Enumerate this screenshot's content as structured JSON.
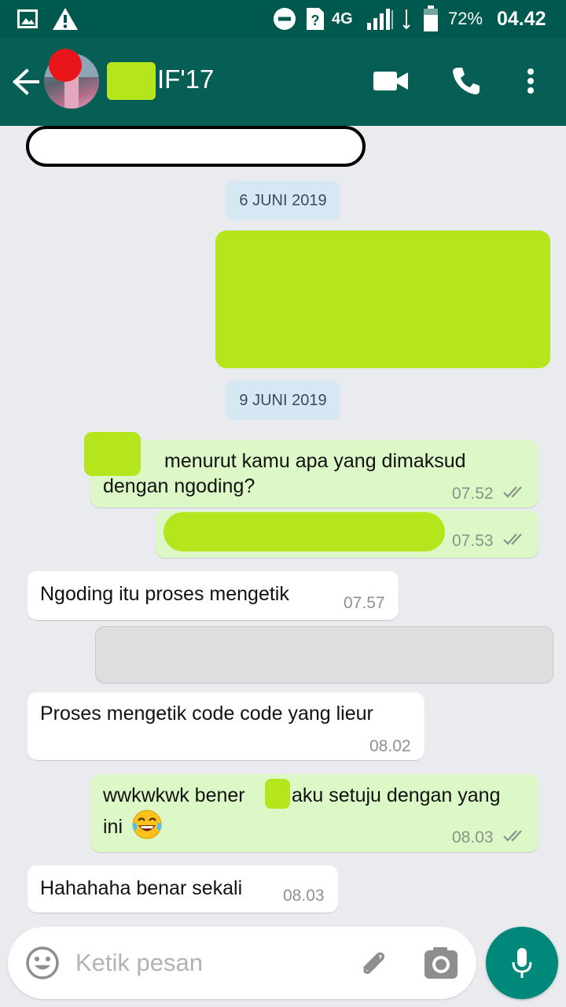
{
  "status_bar": {
    "network": "4G",
    "battery": "72%",
    "time": "04.42"
  },
  "header": {
    "chat_title": "IF'17"
  },
  "messages": [
    {
      "date": "6 JUNI 2019"
    },
    {
      "date": "9 JUNI 2019"
    },
    {
      "text_line1": "menurut kamu apa yang dimaksud",
      "text_line2": "dengan ngoding?",
      "time": "07.52"
    },
    {
      "time": "07.53"
    },
    {
      "text": "Ngoding itu proses mengetik",
      "time": "07.57"
    },
    {
      "text": "Proses mengetik code code yang lieur",
      "time": "08.02"
    },
    {
      "text_part1": "wwkwkwk bener",
      "text_part2": "aku setuju dengan yang",
      "text_line2": "ini",
      "time": "08.03"
    },
    {
      "text": "Hahahaha benar sekali",
      "time": "08.03"
    }
  ],
  "composer": {
    "placeholder": "Ketik pesan"
  },
  "colors": {
    "header": "#075e54",
    "status_bar": "#00594f",
    "outgoing_bubble": "#dcf8c6",
    "incoming_bubble": "#ffffff",
    "redaction": "#b5e61d",
    "mic_button": "#00897b"
  },
  "icons": [
    "back-arrow-icon",
    "video-call-icon",
    "phone-icon",
    "more-vert-icon",
    "emoji-icon",
    "attach-icon",
    "camera-icon",
    "mic-icon",
    "double-check-icon"
  ]
}
